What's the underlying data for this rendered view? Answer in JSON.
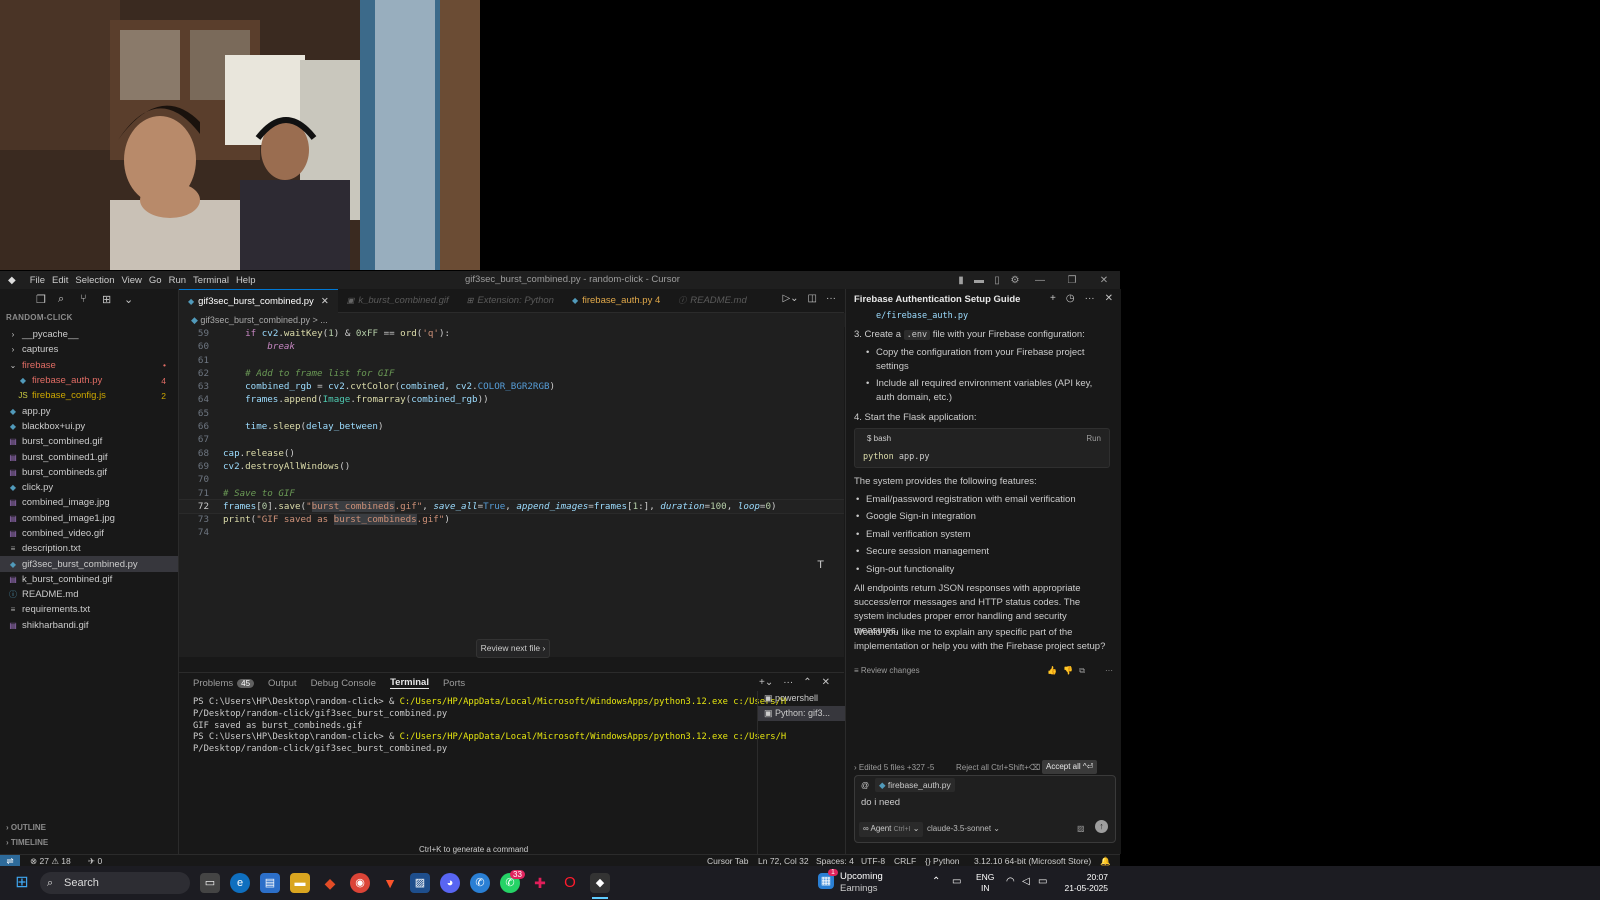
{
  "window": {
    "title": "gif3sec_burst_combined.py - random-click - Cursor",
    "menu": [
      "File",
      "Edit",
      "Selection",
      "View",
      "Go",
      "Run",
      "Terminal",
      "Help"
    ]
  },
  "explorer": {
    "section": "RANDOM-CLICK",
    "items": [
      {
        "label": "__pycache__",
        "type": "folder",
        "indent": 1
      },
      {
        "label": "captures",
        "type": "folder",
        "indent": 1
      },
      {
        "label": "firebase",
        "type": "folder-open",
        "indent": 1,
        "color": "red",
        "badge": "•"
      },
      {
        "label": "firebase_auth.py",
        "type": "py",
        "indent": 2,
        "color": "red",
        "badge": "4"
      },
      {
        "label": "firebase_config.js",
        "type": "js",
        "indent": 2,
        "color": "orange",
        "badge": "2"
      },
      {
        "label": "app.py",
        "type": "py",
        "indent": 1
      },
      {
        "label": "blackbox+ui.py",
        "type": "py",
        "indent": 1
      },
      {
        "label": "burst_combined.gif",
        "type": "img",
        "indent": 1
      },
      {
        "label": "burst_combined1.gif",
        "type": "img",
        "indent": 1
      },
      {
        "label": "burst_combineds.gif",
        "type": "img",
        "indent": 1
      },
      {
        "label": "click.py",
        "type": "py",
        "indent": 1
      },
      {
        "label": "combined_image.jpg",
        "type": "img",
        "indent": 1
      },
      {
        "label": "combined_image1.jpg",
        "type": "img",
        "indent": 1
      },
      {
        "label": "combined_video.gif",
        "type": "img",
        "indent": 1
      },
      {
        "label": "description.txt",
        "type": "txt",
        "indent": 1
      },
      {
        "label": "gif3sec_burst_combined.py",
        "type": "py",
        "indent": 1,
        "active": true
      },
      {
        "label": "k_burst_combined.gif",
        "type": "img",
        "indent": 1
      },
      {
        "label": "README.md",
        "type": "info",
        "indent": 1
      },
      {
        "label": "requirements.txt",
        "type": "txt",
        "indent": 1
      },
      {
        "label": "shikharbandi.gif",
        "type": "img",
        "indent": 1
      }
    ],
    "outline": "OUTLINE",
    "timeline": "TIMELINE"
  },
  "tabs": [
    {
      "label": "gif3sec_burst_combined.py",
      "active": true
    },
    {
      "label": "k_burst_combined.gif",
      "dim": true
    },
    {
      "label": "Extension: Python",
      "dim": true
    },
    {
      "label": "firebase_auth.py 4",
      "warn": true
    },
    {
      "label": "README.md",
      "dim": true
    }
  ],
  "breadcrumb": "gif3sec_burst_combined.py > ...",
  "code": {
    "lines": [
      {
        "no": "59",
        "text": "    if cv2.waitKey(1) & 0xFF == ord('q'):"
      },
      {
        "no": "60",
        "text": "        break"
      },
      {
        "no": "61",
        "text": ""
      },
      {
        "no": "62",
        "text": "    # Add to frame list for GIF"
      },
      {
        "no": "63",
        "text": "    combined_rgb = cv2.cvtColor(combined, cv2.COLOR_BGR2RGB)"
      },
      {
        "no": "64",
        "text": "    frames.append(Image.fromarray(combined_rgb))"
      },
      {
        "no": "65",
        "text": ""
      },
      {
        "no": "66",
        "text": "    time.sleep(delay_between)"
      },
      {
        "no": "67",
        "text": ""
      },
      {
        "no": "68",
        "text": "cap.release()"
      },
      {
        "no": "69",
        "text": "cv2.destroyAllWindows()"
      },
      {
        "no": "70",
        "text": ""
      },
      {
        "no": "71",
        "text": "# Save to GIF"
      },
      {
        "no": "72",
        "text": "frames[0].save(\"burst_combineds.gif\", save_all=True, append_images=frames[1:], duration=100, loop=0)"
      },
      {
        "no": "73",
        "text": "print(\"GIF saved as burst_combineds.gif\")"
      },
      {
        "no": "74",
        "text": ""
      }
    ],
    "review_button": "Review next file"
  },
  "panel": {
    "tabs": [
      "Problems",
      "Output",
      "Debug Console",
      "Terminal",
      "Ports"
    ],
    "problems_count": "45",
    "terminal_lines": [
      "PS C:\\Users\\HP\\Desktop\\random-click> & C:/Users/HP/AppData/Local/Microsoft/WindowsApps/python3.12.exe c:/Users/H",
      "P/Desktop/random-click/gif3sec_burst_combined.py",
      "GIF saved as burst_combineds.gif",
      "PS C:\\Users\\HP\\Desktop\\random-click> & C:/Users/HP/AppData/Local/Microsoft/WindowsApps/python3.12.exe c:/Users/H",
      "P/Desktop/random-click/gif3sec_burst_combined.py"
    ],
    "terminals": [
      "powershell",
      "Python: gif3..."
    ],
    "hint": "Ctrl+K to generate a command"
  },
  "chat": {
    "title": "Firebase Authentication Setup Guide",
    "path_snippet": "e/firebase_auth.py",
    "step3": "3. Create a",
    "step3_code": ".env",
    "step3_rest": "file with your Firebase configuration:",
    "step3_bullets": [
      "Copy the configuration from your Firebase project settings",
      "Include all required environment variables (API key, auth domain, etc.)"
    ],
    "step4": "4. Start the Flask application:",
    "code_lang": "bash",
    "code_run": "Run",
    "code_cmd1": "python",
    "code_cmd2": "app.py",
    "features_intro": "The system provides the following features:",
    "features": [
      "Email/password registration with email verification",
      "Google Sign-in integration",
      "Email verification system",
      "Secure session management",
      "Sign-out functionality"
    ],
    "summary": "All endpoints return JSON responses with appropriate success/error messages and HTTP status codes. The system includes proper error handling and security measures.",
    "question": "Would you like me to explain any specific part of the implementation or help you with the Firebase project setup?",
    "review_changes": "Review changes",
    "edited": "Edited 5 files +327 -5",
    "reject_all": "Reject all Ctrl+Shift+⌫",
    "accept_all": "Accept all ^⏎",
    "context_file": "firebase_auth.py",
    "input_text": "do i need",
    "agent": "Agent",
    "agent_shortcut": "Ctrl+I",
    "model": "claude-3.5-sonnet"
  },
  "statusbar": {
    "errors": "27",
    "warnings": "18",
    "ports": "0",
    "cursor_tab": "Cursor Tab",
    "position": "Ln 72, Col 32",
    "spaces": "Spaces: 4",
    "encoding": "UTF-8",
    "eol": "CRLF",
    "language": "Python",
    "interpreter": "3.12.10 64-bit (Microsoft Store)"
  },
  "taskbar": {
    "search": "Search",
    "weather_title": "Upcoming",
    "weather_sub": "Earnings",
    "weather_badge": "1",
    "whatsapp_badge": "33",
    "lang1": "ENG",
    "lang2": "IN",
    "time": "20:07",
    "date": "21-05-2025"
  }
}
